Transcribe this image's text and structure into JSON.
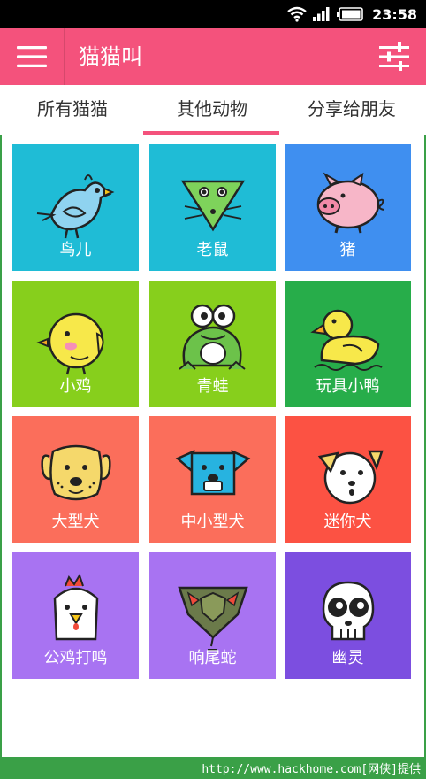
{
  "status_bar": {
    "time": "23:58"
  },
  "app_bar": {
    "title": "猫猫叫"
  },
  "tabs": [
    {
      "label": "所有猫猫"
    },
    {
      "label": "其他动物",
      "active": true
    },
    {
      "label": "分享给朋友"
    }
  ],
  "tiles": [
    {
      "label": "鸟儿",
      "icon": "bird-icon",
      "color": "#1fbcd6"
    },
    {
      "label": "老鼠",
      "icon": "mouse-icon",
      "color": "#1fbcd6"
    },
    {
      "label": "猪",
      "icon": "pig-icon",
      "color": "#3f8ff0"
    },
    {
      "label": "小鸡",
      "icon": "chick-icon",
      "color": "#87cf1c"
    },
    {
      "label": "青蛙",
      "icon": "frog-icon",
      "color": "#87cf1c"
    },
    {
      "label": "玩具小鸭",
      "icon": "duck-icon",
      "color": "#27ad4a"
    },
    {
      "label": "大型犬",
      "icon": "big-dog-icon",
      "color": "#fb6e5b"
    },
    {
      "label": "中小型犬",
      "icon": "medium-dog-icon",
      "color": "#fb6e5b"
    },
    {
      "label": "迷你犬",
      "icon": "mini-dog-icon",
      "color": "#fc5243"
    },
    {
      "label": "公鸡打鸣",
      "icon": "rooster-icon",
      "color": "#a873f2"
    },
    {
      "label": "响尾蛇",
      "icon": "rattlesnake-icon",
      "color": "#a873f2"
    },
    {
      "label": "幽灵",
      "icon": "ghost-skull-icon",
      "color": "#7c4ee0"
    }
  ],
  "footer": {
    "text": "http://www.hackhome.com[网侠]提供"
  },
  "colors": {
    "primary": "#f4527c",
    "status_bar": "#000000",
    "footer": "#3aa047"
  }
}
